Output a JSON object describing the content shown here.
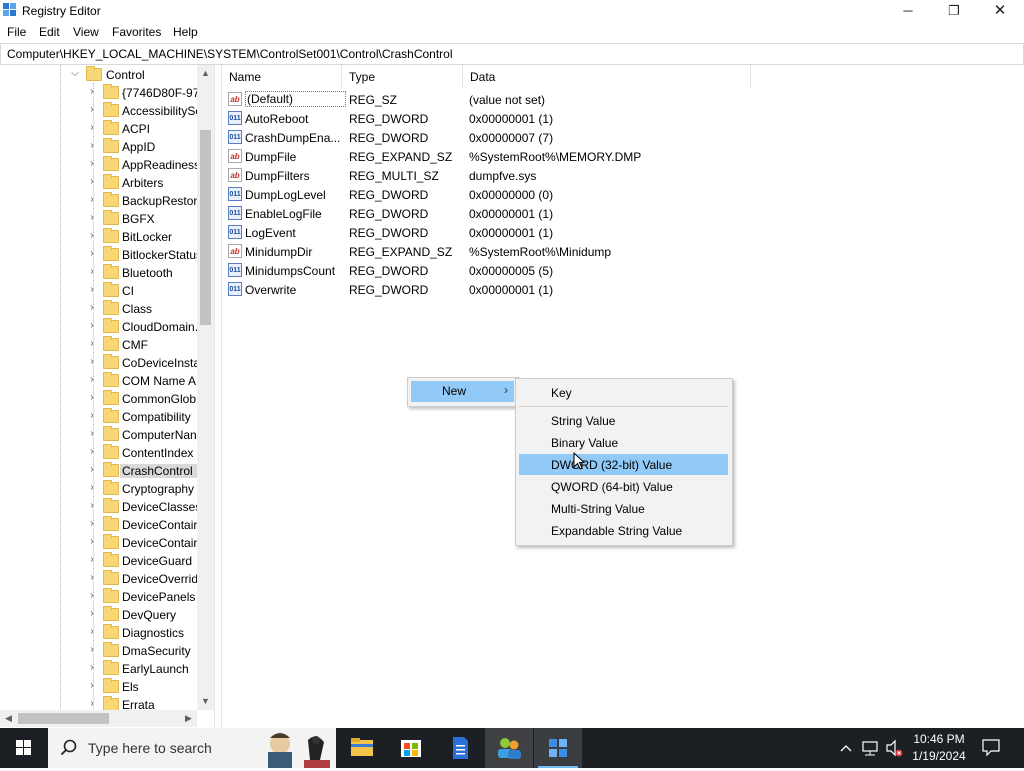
{
  "window": {
    "title": "Registry Editor",
    "minimize_label": "─",
    "maximize_label": "❐",
    "close_label": "✕"
  },
  "menubar": {
    "items": [
      "File",
      "Edit",
      "View",
      "Favorites",
      "Help"
    ]
  },
  "address": {
    "path": "Computer\\HKEY_LOCAL_MACHINE\\SYSTEM\\ControlSet001\\Control\\CrashControl"
  },
  "tree": {
    "parent": "Control",
    "items": [
      "{7746D80F-97E",
      "AccessibilitySe",
      "ACPI",
      "AppID",
      "AppReadiness",
      "Arbiters",
      "BackupRestore",
      "BGFX",
      "BitLocker",
      "BitlockerStatus",
      "Bluetooth",
      "CI",
      "Class",
      "CloudDomain.",
      "CMF",
      "CoDeviceInsta",
      "COM Name A",
      "CommonGlob",
      "Compatibility",
      "ComputerNan",
      "ContentIndex",
      "CrashControl",
      "Cryptography",
      "DeviceClasses",
      "DeviceContair",
      "DeviceContair",
      "DeviceGuard",
      "DeviceOverrid",
      "DevicePanels",
      "DevQuery",
      "Diagnostics",
      "DmaSecurity",
      "EarlyLaunch",
      "Els",
      "Errata"
    ],
    "selected": "CrashControl"
  },
  "list": {
    "headers": {
      "name": "Name",
      "type": "Type",
      "data": "Data"
    },
    "rows": [
      {
        "icon": "ab",
        "name": "(Default)",
        "type": "REG_SZ",
        "data": "(value not set)"
      },
      {
        "icon": "bin",
        "name": "AutoReboot",
        "type": "REG_DWORD",
        "data": "0x00000001 (1)"
      },
      {
        "icon": "bin",
        "name": "CrashDumpEna...",
        "type": "REG_DWORD",
        "data": "0x00000007 (7)"
      },
      {
        "icon": "ab",
        "name": "DumpFile",
        "type": "REG_EXPAND_SZ",
        "data": "%SystemRoot%\\MEMORY.DMP"
      },
      {
        "icon": "ab",
        "name": "DumpFilters",
        "type": "REG_MULTI_SZ",
        "data": "dumpfve.sys"
      },
      {
        "icon": "bin",
        "name": "DumpLogLevel",
        "type": "REG_DWORD",
        "data": "0x00000000 (0)"
      },
      {
        "icon": "bin",
        "name": "EnableLogFile",
        "type": "REG_DWORD",
        "data": "0x00000001 (1)"
      },
      {
        "icon": "bin",
        "name": "LogEvent",
        "type": "REG_DWORD",
        "data": "0x00000001 (1)"
      },
      {
        "icon": "ab",
        "name": "MinidumpDir",
        "type": "REG_EXPAND_SZ",
        "data": "%SystemRoot%\\Minidump"
      },
      {
        "icon": "bin",
        "name": "MinidumpsCount",
        "type": "REG_DWORD",
        "data": "0x00000005 (5)"
      },
      {
        "icon": "bin",
        "name": "Overwrite",
        "type": "REG_DWORD",
        "data": "0x00000001 (1)"
      }
    ]
  },
  "context_menu": {
    "parent_label": "New",
    "parent_arrow": "›",
    "submenu": [
      "Key",
      "String Value",
      "Binary Value",
      "DWORD (32-bit) Value",
      "QWORD (64-bit) Value",
      "Multi-String Value",
      "Expandable String Value"
    ],
    "highlighted": "DWORD (32-bit) Value"
  },
  "taskbar": {
    "search_placeholder": "Type here to search",
    "time": "10:46 PM",
    "date": "1/19/2024"
  },
  "colors": {
    "menu_highlight": "#91c9f7",
    "taskbar_bg": "#1c1f24",
    "folder_yellow": "#f7d776",
    "accent": "#76b9ed"
  }
}
